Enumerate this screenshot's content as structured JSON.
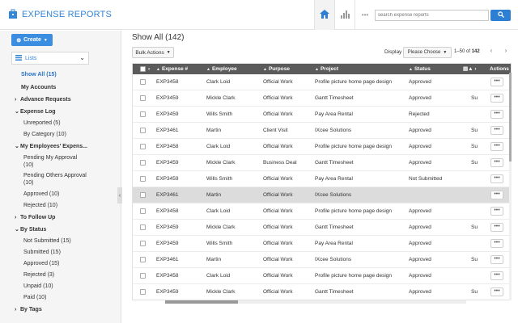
{
  "header": {
    "title": "EXPENSE REPORTS",
    "search_placeholder": "search expense reports",
    "tools": [
      "home-icon",
      "chart-icon",
      "more-icon"
    ],
    "accent": "#3385d6"
  },
  "sidebar": {
    "create_label": "Create",
    "lists_label": "Lists",
    "items": [
      {
        "label": "Show All (15)"
      },
      {
        "label": "My Accounts"
      },
      {
        "label": "Advance Requests"
      },
      {
        "label": "Expense Log"
      },
      {
        "label": "Unreported (5)"
      },
      {
        "label": "By Category (10)"
      },
      {
        "label": "My Employees' Expens..."
      },
      {
        "label": "Pending My Approval"
      },
      {
        "label": "(10)"
      },
      {
        "label": "Pending Others Approval"
      },
      {
        "label": "(10)"
      },
      {
        "label": "Approved (10)"
      },
      {
        "label": "Rejected (10)"
      },
      {
        "label": "To Follow Up"
      },
      {
        "label": "By Status"
      },
      {
        "label": "Not Submitted (15)"
      },
      {
        "label": "Submitted (15)"
      },
      {
        "label": "Approved (15)"
      },
      {
        "label": "Rejected (3)"
      },
      {
        "label": "Unpaid (10)"
      },
      {
        "label": "Paid (10)"
      },
      {
        "label": "By Tags"
      }
    ]
  },
  "main": {
    "title": "Show All (142)",
    "bulk_actions_label": "Bulk Actions",
    "display_label": "Display",
    "display_value": "Please Choose",
    "pager": {
      "prefix": "1–50 of",
      "total": "142"
    },
    "columns": {
      "expense": "Expense #",
      "employee": "Employee",
      "purpose": "Purpose",
      "project": "Project",
      "status": "Status",
      "actions": "Actions"
    },
    "rows": [
      {
        "expense": "EXP3458",
        "employee": "Clark Loid",
        "purpose": "Official Work",
        "project": "Profile picture home page design",
        "status": "Approved",
        "extra": ""
      },
      {
        "expense": "EXP3459",
        "employee": "Mickle Clark",
        "purpose": "Official Work",
        "project": "Gantt Timesheet",
        "status": "Approved",
        "extra": "Su"
      },
      {
        "expense": "EXP3459",
        "employee": "Wills Smith",
        "purpose": "Official Work",
        "project": "Pay Area Rental",
        "status": "Rejected",
        "extra": ""
      },
      {
        "expense": "EXP3461",
        "employee": "Martin",
        "purpose": "Client Visit",
        "project": "IXcee Solutions",
        "status": "Approved",
        "extra": "Su"
      },
      {
        "expense": "EXP3458",
        "employee": "Clark Loid",
        "purpose": "Official Work",
        "project": "Profile picture home page design",
        "status": "Approved",
        "extra": "Su"
      },
      {
        "expense": "EXP3459",
        "employee": "Mickle Clark",
        "purpose": "Business Deal",
        "project": "Gantt Timesheet",
        "status": "Approved",
        "extra": "Su"
      },
      {
        "expense": "EXP3459",
        "employee": "Wills Smith",
        "purpose": "Official Work",
        "project": "Pay Area Rental",
        "status": "Not Submitted",
        "extra": ""
      },
      {
        "expense": "EXP3461",
        "employee": "Martin",
        "purpose": "Official Work",
        "project": "IXcee Solutions",
        "status": "",
        "extra": ""
      },
      {
        "expense": "EXP3458",
        "employee": "Clark Loid",
        "purpose": "Official Work",
        "project": "Profile picture home page design",
        "status": "Approved",
        "extra": ""
      },
      {
        "expense": "EXP3459",
        "employee": "Mickle Clark",
        "purpose": "Official Work",
        "project": "Gantt Timesheet",
        "status": "Approved",
        "extra": "Su"
      },
      {
        "expense": "EXP3459",
        "employee": "Wills Smith",
        "purpose": "Official Work",
        "project": "Pay Area Rental",
        "status": "Approved",
        "extra": ""
      },
      {
        "expense": "EXP3461",
        "employee": "Martin",
        "purpose": "Official Work",
        "project": "IXcee Solutions",
        "status": "Approved",
        "extra": "Su"
      },
      {
        "expense": "EXP3458",
        "employee": "Clark Loid",
        "purpose": "Official Work",
        "project": "Profile picture home page design",
        "status": "Approved",
        "extra": ""
      },
      {
        "expense": "EXP3459",
        "employee": "Mickle Clark",
        "purpose": "Official Work",
        "project": "Gantt Timesheet",
        "status": "Approved",
        "extra": "Su"
      }
    ]
  }
}
